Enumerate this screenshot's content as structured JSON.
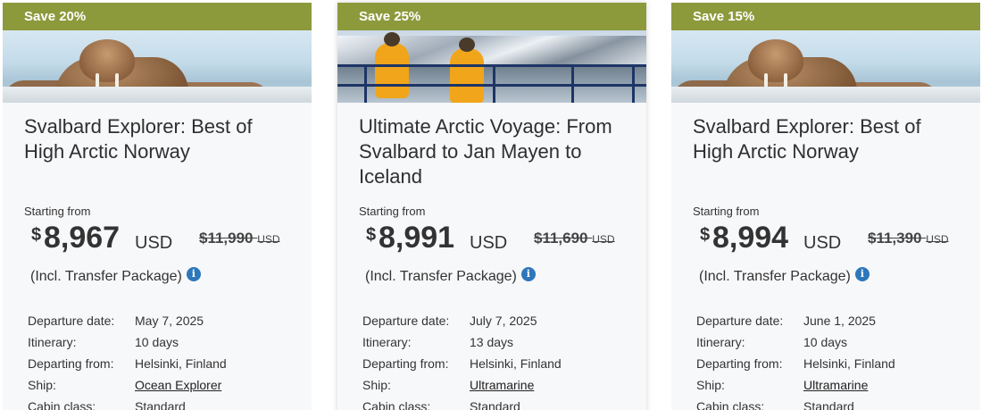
{
  "cards": [
    {
      "banner": "Save 20%",
      "image": "walrus-photo",
      "title": "Svalbard Explorer: Best of High Arctic Norway",
      "starting_from": "Starting from",
      "currency_symbol": "$",
      "price": "8,967",
      "currency": "USD",
      "old_price": "$11,990",
      "old_currency": "USD",
      "incl": "(Incl. Transfer Package)",
      "details": {
        "departure_label": "Departure date:",
        "departure": "May 7, 2025",
        "itinerary_label": "Itinerary:",
        "itinerary": "10 days",
        "departing_label": "Departing from:",
        "departing": "Helsinki, Finland",
        "ship_label": "Ship:",
        "ship": "Ocean Explorer",
        "cabin_label": "Cabin class:",
        "cabin": "Standard"
      }
    },
    {
      "banner": "Save 25%",
      "image": "arctic-voyage-photo",
      "title": "Ultimate Arctic Voyage: From Svalbard to Jan Mayen to Iceland",
      "starting_from": "Starting from",
      "currency_symbol": "$",
      "price": "8,991",
      "currency": "USD",
      "old_price": "$11,690",
      "old_currency": "USD",
      "incl": "(Incl. Transfer Package)",
      "details": {
        "departure_label": "Departure date:",
        "departure": "July 7, 2025",
        "itinerary_label": "Itinerary:",
        "itinerary": "13 days",
        "departing_label": "Departing from:",
        "departing": "Helsinki, Finland",
        "ship_label": "Ship:",
        "ship": "Ultramarine",
        "cabin_label": "Cabin class:",
        "cabin": "Standard"
      }
    },
    {
      "banner": "Save 15%",
      "image": "walrus-photo",
      "title": "Svalbard Explorer: Best of High Arctic Norway",
      "starting_from": "Starting from",
      "currency_symbol": "$",
      "price": "8,994",
      "currency": "USD",
      "old_price": "$11,390",
      "old_currency": "USD",
      "incl": "(Incl. Transfer Package)",
      "details": {
        "departure_label": "Departure date:",
        "departure": "June 1, 2025",
        "itinerary_label": "Itinerary:",
        "itinerary": "10 days",
        "departing_label": "Departing from:",
        "departing": "Helsinki, Finland",
        "ship_label": "Ship:",
        "ship": "Ultramarine",
        "cabin_label": "Cabin class:",
        "cabin": "Standard"
      }
    }
  ],
  "info_icon": "info-icon",
  "colors": {
    "banner": "#8c9a3c",
    "info": "#2e77bb",
    "card_bg": "#f7f8fa"
  }
}
